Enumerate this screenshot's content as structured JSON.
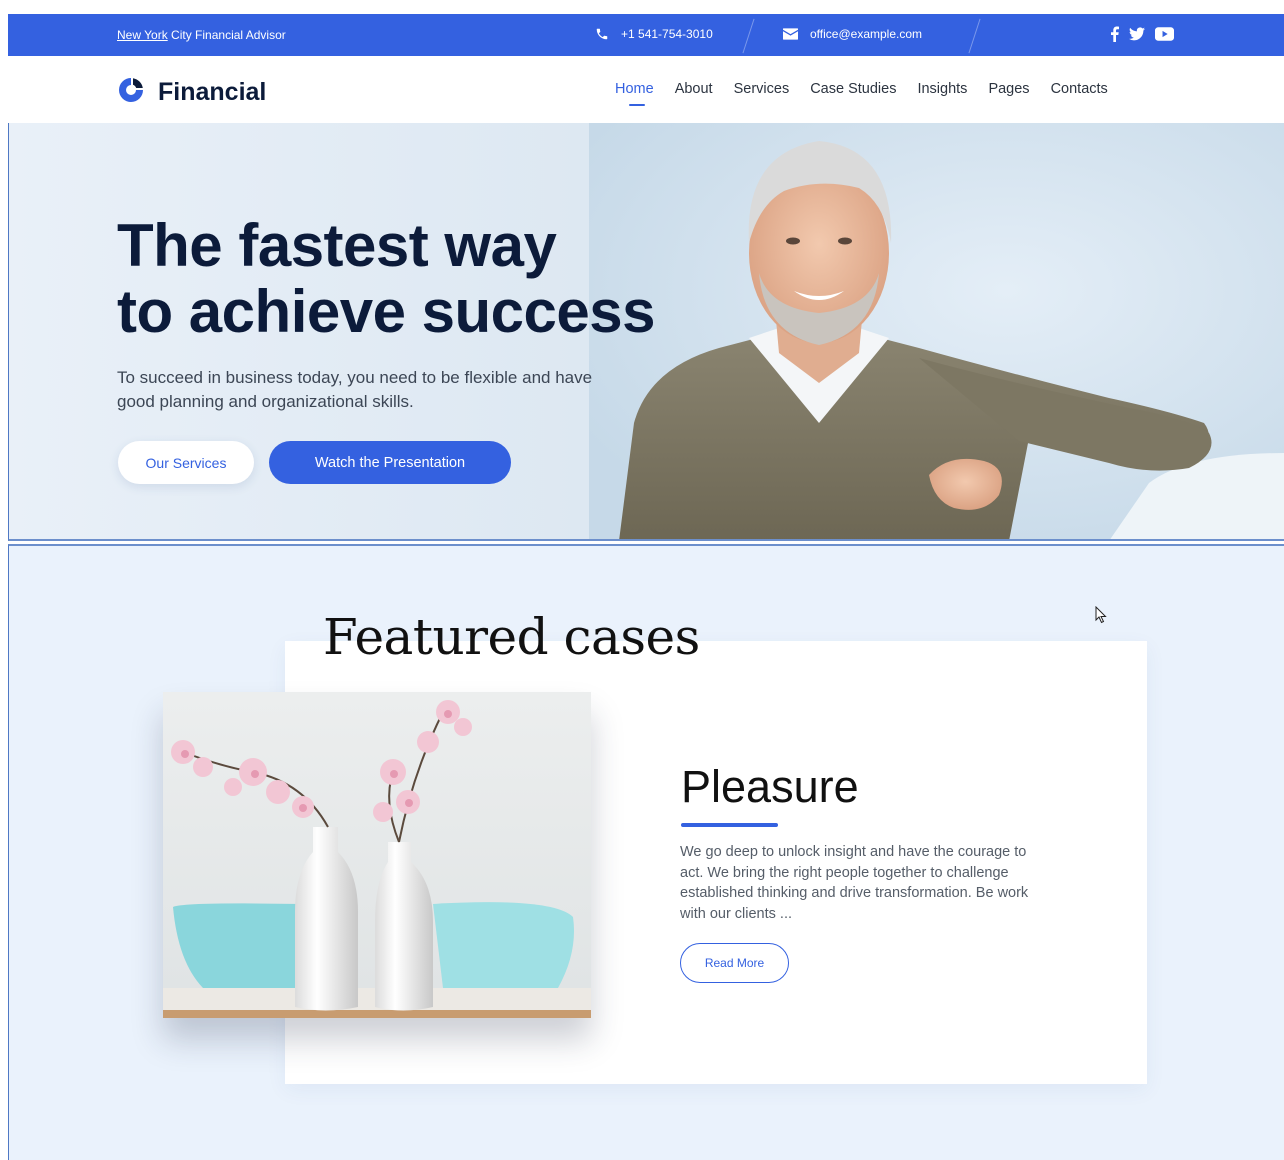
{
  "topbar": {
    "tagline_link": "New York",
    "tagline_rest": "City Financial Advisor",
    "phone": "+1 541-754-3010",
    "email": "office@example.com",
    "social_icons": [
      "facebook-icon",
      "twitter-icon",
      "youtube-icon"
    ]
  },
  "brand": {
    "name": "Financial",
    "accent_color": "#3461e0",
    "dark_color": "#0c1b3a"
  },
  "nav": {
    "items": [
      "Home",
      "About",
      "Services",
      "Case Studies",
      "Insights",
      "Pages",
      "Contacts"
    ],
    "active": "Home"
  },
  "hero": {
    "title_line1": "The fastest way",
    "title_line2": "to achieve success",
    "subtitle": "To succeed in business today, you need to be flexible and have good planning and organizational skills.",
    "button_primary": "Our Services",
    "button_secondary": "Watch the Presentation"
  },
  "featured": {
    "heading": "Featured cases",
    "case_title": "Pleasure",
    "case_text": "We go deep to unlock insight and have the courage to act. We bring the right people together to challenge established thinking and drive transformation. Be work with our clients ...",
    "read_more": "Read More"
  }
}
